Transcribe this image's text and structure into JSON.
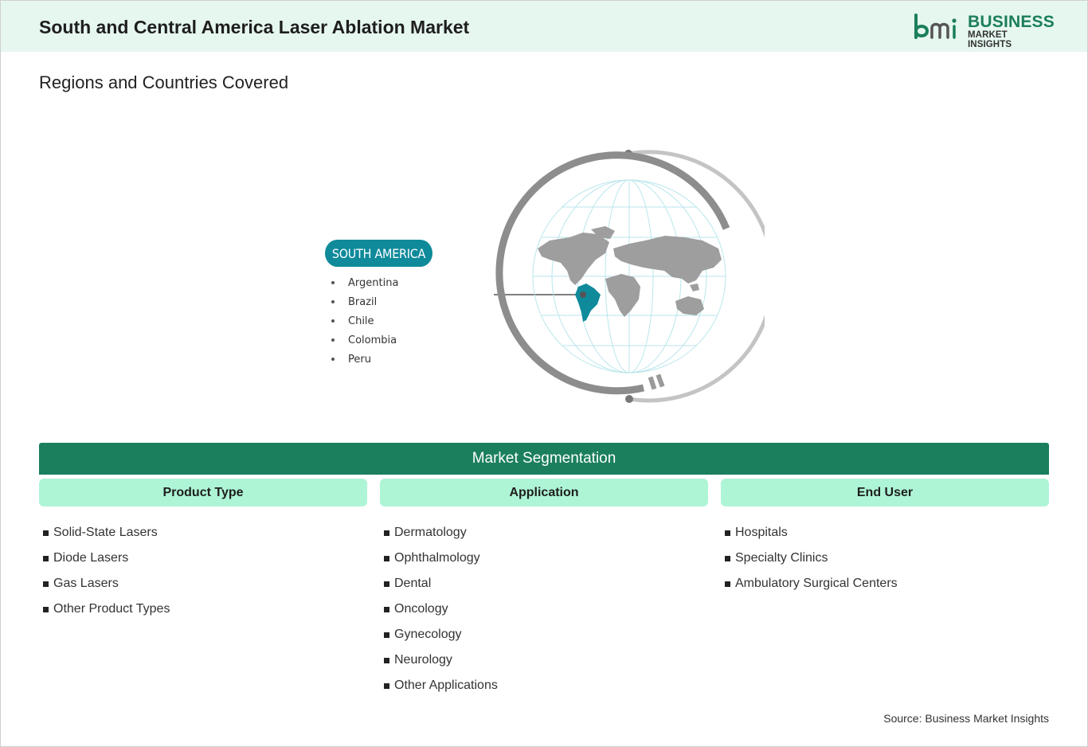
{
  "header": {
    "title": "South and Central America Laser Ablation Market"
  },
  "logo": {
    "word1": "BUSINESS",
    "word2": "MARKET INSIGHTS",
    "mark": "bmi-logo"
  },
  "regions_section": {
    "title": "Regions and Countries Covered"
  },
  "region": {
    "name": "SOUTH AMERICA",
    "countries": [
      "Argentina",
      "Brazil",
      "Chile",
      "Colombia",
      "Peru"
    ]
  },
  "segmentation": {
    "title": "Market Segmentation",
    "columns": [
      {
        "heading": "Product Type",
        "items": [
          "Solid-State Lasers",
          "Diode Lasers",
          "Gas Lasers",
          "Other Product Types"
        ]
      },
      {
        "heading": "Application",
        "items": [
          "Dermatology",
          "Ophthalmology",
          "Dental",
          "Oncology",
          "Gynecology",
          "Neurology",
          "Other Applications"
        ]
      },
      {
        "heading": "End User",
        "items": [
          "Hospitals",
          "Specialty Clinics",
          "Ambulatory Surgical Centers"
        ]
      }
    ]
  },
  "source": "Source: Business Market Insights",
  "colors": {
    "header_bg": "#e6f7ef",
    "brand_green": "#1b7f5e",
    "teal": "#0f8a9b",
    "segment_head": "#aef5d6"
  }
}
